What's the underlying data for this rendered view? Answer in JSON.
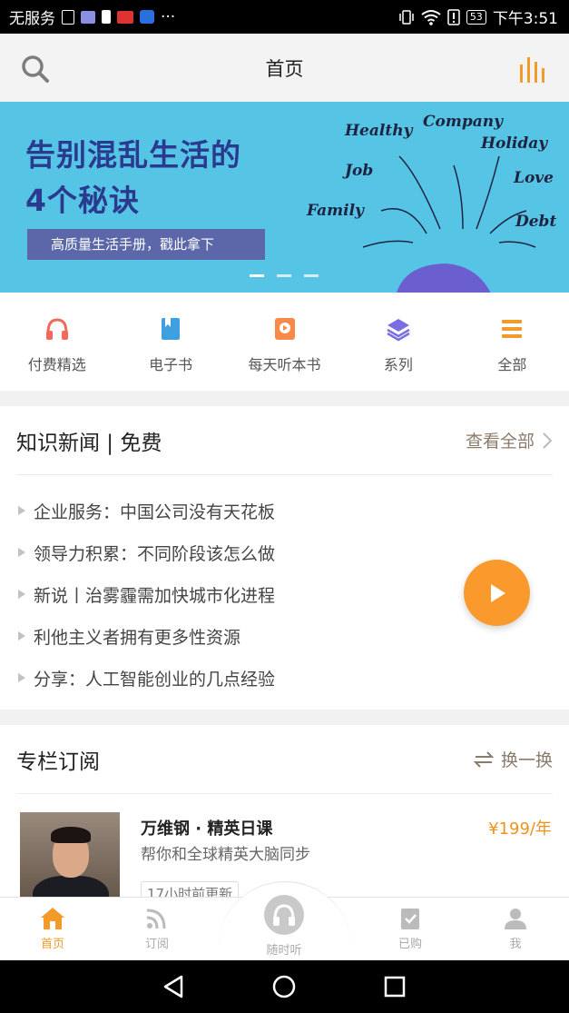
{
  "status_bar": {
    "carrier": "无服务",
    "battery": "53",
    "time": "下午3:51",
    "more": "···"
  },
  "header": {
    "title": "首页",
    "left_icon": "search-icon",
    "right_icon": "audio-bars-icon"
  },
  "banner": {
    "headline_line1": "告别混乱生活的",
    "headline_line2": "4个秘诀",
    "cta": "高质量生活手册，戳此拿下",
    "words": [
      "Healthy",
      "Company",
      "Holiday",
      "Job",
      "Love",
      "Family",
      "Debt"
    ],
    "page_count": 3,
    "active_page": 1
  },
  "categories": [
    {
      "label": "付费精选",
      "icon": "headphones-icon"
    },
    {
      "label": "电子书",
      "icon": "book-icon"
    },
    {
      "label": "每天听本书",
      "icon": "play-book-icon"
    },
    {
      "label": "系列",
      "icon": "layers-icon"
    },
    {
      "label": "全部",
      "icon": "menu-icon"
    }
  ],
  "news": {
    "title": "知识新闻 | 免费",
    "more": "查看全部",
    "items": [
      "企业服务：中国公司没有天花板",
      "领导力积累：不同阶段该怎么做",
      "新说丨治雾霾需加快城市化进程",
      "利他主义者拥有更多性资源",
      "分享：人工智能创业的几点经验"
    ]
  },
  "columns": {
    "title": "专栏订阅",
    "refresh": "换一换",
    "items": [
      {
        "name": "万维钢 · 精英日课",
        "desc": "帮你和全球精英大脑同步",
        "price": "¥199/年",
        "tag": "17小时前更新"
      }
    ]
  },
  "tabs": [
    {
      "label": "首页",
      "icon": "home-icon",
      "active": true
    },
    {
      "label": "订阅",
      "icon": "rss-icon",
      "active": false
    },
    {
      "label": "随时听",
      "icon": "headphones-icon",
      "active": false
    },
    {
      "label": "已购",
      "icon": "clipboard-check-icon",
      "active": false
    },
    {
      "label": "我",
      "icon": "user-icon",
      "active": false
    }
  ],
  "colors": {
    "accent": "#f29a2a",
    "banner_bg": "#56c4e4",
    "headline": "#2a3a8e",
    "play_button": "#fb9a2c"
  }
}
